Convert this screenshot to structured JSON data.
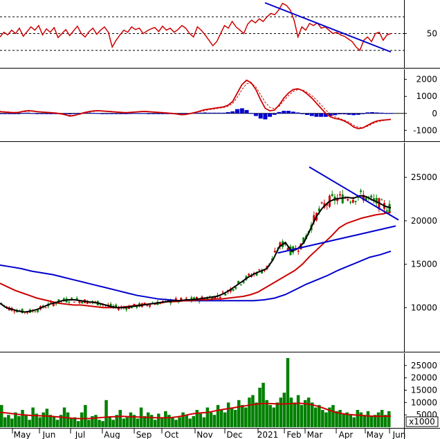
{
  "chart_data": [
    {
      "type": "line",
      "panel": "oscillator",
      "ylim": [
        0,
        100
      ],
      "ytick_labels": [
        {
          "label": "50",
          "value": 50
        }
      ],
      "reference_lines": [
        75,
        50,
        25
      ],
      "series": [
        {
          "color": "#cc0000",
          "values": [
            45,
            52,
            48,
            55,
            50,
            58,
            46,
            53,
            60,
            55,
            62,
            48,
            57,
            52,
            59,
            44,
            50,
            56,
            47,
            54,
            61,
            50,
            45,
            53,
            58,
            49,
            55,
            60,
            52,
            30,
            40,
            48,
            55,
            52,
            60,
            56,
            58,
            50,
            54,
            57,
            59,
            53,
            61,
            55,
            58,
            52,
            56,
            62,
            58,
            50,
            45,
            60,
            55,
            48,
            40,
            32,
            38,
            50,
            62,
            58,
            68,
            60,
            55,
            50,
            64,
            70,
            66,
            72,
            68,
            75,
            80,
            78,
            85,
            95,
            92,
            85,
            70,
            45,
            60,
            55,
            65,
            62,
            66,
            58,
            60,
            55,
            50,
            52,
            48,
            46,
            42,
            38,
            30,
            25,
            40,
            45,
            38,
            50,
            52,
            40,
            48,
            50
          ]
        }
      ]
    },
    {
      "type": "line",
      "panel": "macd",
      "ylim": [
        -1600,
        2600
      ],
      "ytick_labels": [
        {
          "label": "2000",
          "value": 2000
        },
        {
          "label": "1000",
          "value": 1000
        },
        {
          "label": "0",
          "value": 0
        },
        {
          "label": "-1000",
          "value": -1000
        }
      ],
      "series": [
        {
          "color": "#cc0000",
          "values": [
            100,
            80,
            60,
            40,
            60,
            120,
            160,
            140,
            100,
            80,
            60,
            40,
            20,
            -20,
            -80,
            -160,
            -120,
            -40,
            40,
            100,
            140,
            160,
            140,
            120,
            100,
            80,
            60,
            40,
            60,
            80,
            100,
            120,
            100,
            80,
            60,
            40,
            20,
            0,
            -40,
            -80,
            -60,
            0,
            60,
            140,
            220,
            260,
            300,
            340,
            380,
            480,
            700,
            1200,
            1700,
            1950,
            1800,
            1400,
            800,
            300,
            150,
            200,
            500,
            900,
            1200,
            1400,
            1450,
            1350,
            1150,
            900,
            600,
            300,
            0,
            -200,
            -300,
            -350,
            -450,
            -600,
            -800,
            -900,
            -850,
            -700,
            -550,
            -450,
            -400,
            -380,
            -350
          ]
        },
        {
          "color": "#cc0000",
          "dashed": true,
          "values": [
            120,
            100,
            80,
            60,
            60,
            90,
            120,
            130,
            110,
            90,
            70,
            55,
            35,
            5,
            -45,
            -110,
            -110,
            -70,
            0,
            60,
            110,
            140,
            140,
            130,
            115,
            95,
            75,
            55,
            55,
            70,
            90,
            105,
            100,
            85,
            70,
            55,
            35,
            15,
            -15,
            -50,
            -55,
            -20,
            30,
            100,
            170,
            220,
            260,
            300,
            340,
            410,
            580,
            950,
            1400,
            1750,
            1780,
            1550,
            1100,
            650,
            350,
            280,
            420,
            750,
            1050,
            1300,
            1400,
            1380,
            1240,
            1050,
            800,
            500,
            200,
            -50,
            -200,
            -300,
            -400,
            -520,
            -700,
            -820,
            -840,
            -760,
            -620,
            -500,
            -440,
            -400,
            -370
          ]
        },
        {
          "color": "#0000cc",
          "kind": "histogram",
          "values": [
            -20,
            -20,
            -20,
            -20,
            0,
            30,
            40,
            10,
            -10,
            -10,
            -10,
            -15,
            -15,
            -25,
            -35,
            -50,
            -10,
            30,
            40,
            40,
            30,
            20,
            0,
            -10,
            -15,
            -15,
            -15,
            -15,
            5,
            10,
            10,
            15,
            0,
            -5,
            -10,
            -15,
            -15,
            -15,
            -25,
            -30,
            -5,
            20,
            30,
            40,
            50,
            40,
            40,
            40,
            40,
            70,
            120,
            250,
            300,
            200,
            20,
            -150,
            -300,
            -350,
            -200,
            -80,
            80,
            150,
            150,
            100,
            50,
            -30,
            -90,
            -150,
            -200,
            -200,
            -200,
            -150,
            -100,
            -50,
            -50,
            -80,
            -100,
            -80,
            -10,
            60,
            70,
            50,
            40,
            20,
            20
          ]
        }
      ]
    },
    {
      "type": "line",
      "panel": "price",
      "ylim": [
        5000,
        29000
      ],
      "ytick_labels": [
        {
          "label": "25000",
          "value": 25000
        },
        {
          "label": "20000",
          "value": 20000
        },
        {
          "label": "15000",
          "value": 15000
        },
        {
          "label": "10000",
          "value": 10000
        }
      ],
      "series": [
        {
          "color": "#000000",
          "values": [
            10500,
            10000,
            9800,
            9600,
            9500,
            9600,
            9800,
            10100,
            10400,
            10600,
            10800,
            10900,
            10900,
            10800,
            10700,
            10600,
            10500,
            10300,
            10100,
            10000,
            10000,
            10100,
            10200,
            10300,
            10400,
            10500,
            10600,
            10700,
            10800,
            10800,
            10900,
            10900,
            11000,
            11100,
            11200,
            11300,
            11600,
            12000,
            12500,
            13000,
            13500,
            13900,
            14200,
            14500,
            15500,
            17000,
            17500,
            16500,
            16800,
            17500,
            19000,
            20500,
            21500,
            22200,
            22500,
            22600,
            22700,
            22600,
            22900,
            22800,
            22400,
            22100,
            21700,
            21500
          ]
        },
        {
          "color": "#cc0000",
          "values": [
            12800,
            12400,
            12000,
            11700,
            11400,
            11100,
            10900,
            10700,
            10500,
            10400,
            10300,
            10300,
            10200,
            10100,
            10000,
            10000,
            10000,
            10100,
            10200,
            10300,
            10400,
            10500,
            10600,
            10700,
            10700,
            10800,
            10800,
            10900,
            10900,
            11000,
            11000,
            11100,
            11200,
            11300,
            11500,
            11800,
            12300,
            12800,
            13300,
            13800,
            14300,
            15000,
            15900,
            16700,
            17500,
            18300,
            19200,
            19700,
            20000,
            20300,
            20500,
            20700,
            20800,
            21000
          ]
        },
        {
          "color": "#0000cc",
          "values": [
            14900,
            14700,
            14500,
            14200,
            14000,
            13800,
            13500,
            13200,
            12900,
            12600,
            12300,
            12000,
            11700,
            11400,
            11200,
            11000,
            10900,
            10800,
            10800,
            10800,
            10800,
            10800,
            10800,
            10800,
            10800,
            10900,
            11100,
            11500,
            12100,
            12700,
            13200,
            13700,
            14300,
            14800,
            15300,
            15800,
            16100,
            16500
          ]
        },
        {
          "color": "#0000cc",
          "kind": "trendline_upper",
          "values": [
            26200,
            20100
          ]
        },
        {
          "color": "#0000cc",
          "kind": "trendline_lower",
          "values": [
            16300,
            19400
          ]
        }
      ]
    },
    {
      "type": "bar",
      "panel": "volume",
      "ylim": [
        0,
        30000
      ],
      "ytick_labels": [
        {
          "label": "25000",
          "value": 25000
        },
        {
          "label": "20000",
          "value": 20000
        },
        {
          "label": "15000",
          "value": 15000
        },
        {
          "label": "10000",
          "value": 10000
        },
        {
          "label": "5000",
          "value": 5000
        }
      ],
      "multiplier_label": "x1000",
      "series": [
        {
          "color": "#008000",
          "values": [
            9000,
            4000,
            5000,
            3500,
            6000,
            4500,
            7000,
            5000,
            3000,
            8000,
            5500,
            4000,
            6000,
            7500,
            5000,
            4500,
            3000,
            5000,
            8000,
            6000,
            3500,
            4000,
            2500,
            6000,
            9000,
            3000,
            4500,
            5000,
            3000,
            2500,
            11000,
            4000,
            3000,
            5000,
            7000,
            3500,
            4000,
            6000,
            5000,
            3500,
            8000,
            4500,
            6000,
            5000,
            3000,
            5500,
            4000,
            6500,
            5000,
            4000,
            3000,
            4000,
            6000,
            5000,
            3500,
            4500,
            7000,
            5500,
            4000,
            8000,
            6000,
            5000,
            9000,
            7000,
            6000,
            10000,
            8000,
            7000,
            11000,
            9000,
            8000,
            12000,
            13000,
            10000,
            16000,
            18000,
            11000,
            9000,
            8000,
            10000,
            12000,
            14000,
            28000,
            12000,
            10000,
            13000,
            9000,
            11000,
            12000,
            10000,
            8000,
            9000,
            7000,
            6000,
            8000,
            9000,
            6500,
            7000,
            5500,
            6000,
            5000,
            4000,
            7000,
            6000,
            5000,
            6500,
            4500,
            5000,
            6000,
            7000,
            5000,
            6500
          ]
        },
        {
          "color": "#cc0000",
          "values": [
            6000,
            5800,
            5500,
            5200,
            5000,
            4800,
            4700,
            4600,
            4500,
            4300,
            4100,
            3800,
            3600,
            3500,
            3500,
            3600,
            3800,
            4000,
            4200,
            4300,
            4400,
            4300,
            4200,
            4100,
            4000,
            3900,
            3800,
            3800,
            3900,
            4200,
            4600,
            5200,
            5600,
            5800,
            6000,
            6500,
            7000,
            7400,
            7800,
            8200,
            8600,
            9000,
            9400,
            9600,
            9600,
            9500,
            9400,
            9500,
            9600,
            9700,
            9500,
            9200,
            8500,
            7700,
            6800,
            6000,
            5500,
            5200,
            5000,
            4800,
            4600,
            4500,
            4400,
            4500,
            4500
          ]
        }
      ]
    }
  ],
  "x_axis": {
    "labels": [
      "May",
      "Jun",
      "Jul",
      "Aug",
      "Sep",
      "Oct",
      "Nov",
      "Dec",
      "2021",
      "Feb",
      "Mar",
      "Apr",
      "May",
      "Jun"
    ]
  }
}
